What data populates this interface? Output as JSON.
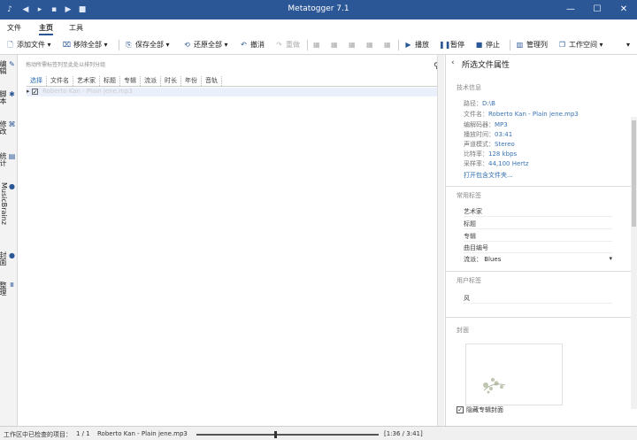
{
  "window": {
    "title": "Metatogger 7.1"
  },
  "menu": {
    "items": [
      "文件",
      "主页",
      "工具"
    ]
  },
  "toolbar": {
    "add_files": "添加文件",
    "remove_all": "移除全部",
    "save_all": "保存全部",
    "restore_all": "还原全部",
    "undo": "撤消",
    "redo": "重做",
    "play": "播放",
    "pause": "暂停",
    "stop": "停止",
    "manage_columns": "管理列",
    "workspace": "工作空间"
  },
  "sidebar": {
    "tabs": [
      "编辑",
      "脚本",
      "修改",
      "统计",
      "MusicBrainz",
      "封面",
      "整理"
    ]
  },
  "file_list": {
    "search_placeholder": "拖动所需标签列至此处以排列分组",
    "columns": [
      "选择",
      "文件名",
      "艺术家",
      "标题",
      "专辑",
      "流派",
      "时长",
      "年份",
      "音轨"
    ],
    "rows": [
      {
        "selected": true,
        "file_name": "Roberto Kan - Plain jene.mp3"
      }
    ]
  },
  "properties": {
    "header": "所选文件属性",
    "tech_section": "技术信息",
    "tech": [
      {
        "label": "路径：",
        "value": "D:\\B"
      },
      {
        "label": "文件名：",
        "value": "Roberto Kan - Plain jene.mp3"
      },
      {
        "label": "编解码器：",
        "value": "MP3"
      },
      {
        "label": "播放时间：",
        "value": "03:41"
      },
      {
        "label": "声道模式：",
        "value": "Stereo"
      },
      {
        "label": "比特率：",
        "value": "128 kbps"
      },
      {
        "label": "采样率：",
        "value": "44,100 Hertz"
      }
    ],
    "open_folder_link": "打开包含文件夹...",
    "common_tags_section": "常用标签",
    "common_tags": [
      {
        "label": "艺术家",
        "value": ""
      },
      {
        "label": "标题",
        "value": ""
      },
      {
        "label": "专辑",
        "value": ""
      },
      {
        "label": "曲目编号",
        "value": ""
      }
    ],
    "genre_label": "流派：",
    "genre_value": "Blues",
    "user_tags_section": "用户标签",
    "user_tags": [
      {
        "label": "风",
        "value": ""
      }
    ],
    "cover_section": "封面",
    "hide_cover_label": "隐藏专辑封面",
    "hide_cover_checked": true
  },
  "status": {
    "items_label": "工作区中已检查的项目：",
    "count": "1 / 1",
    "now_playing": "Roberto Kan - Plain jene.mp3",
    "time": "[1:36 / 3:41]",
    "progress_fraction": 0.434
  }
}
